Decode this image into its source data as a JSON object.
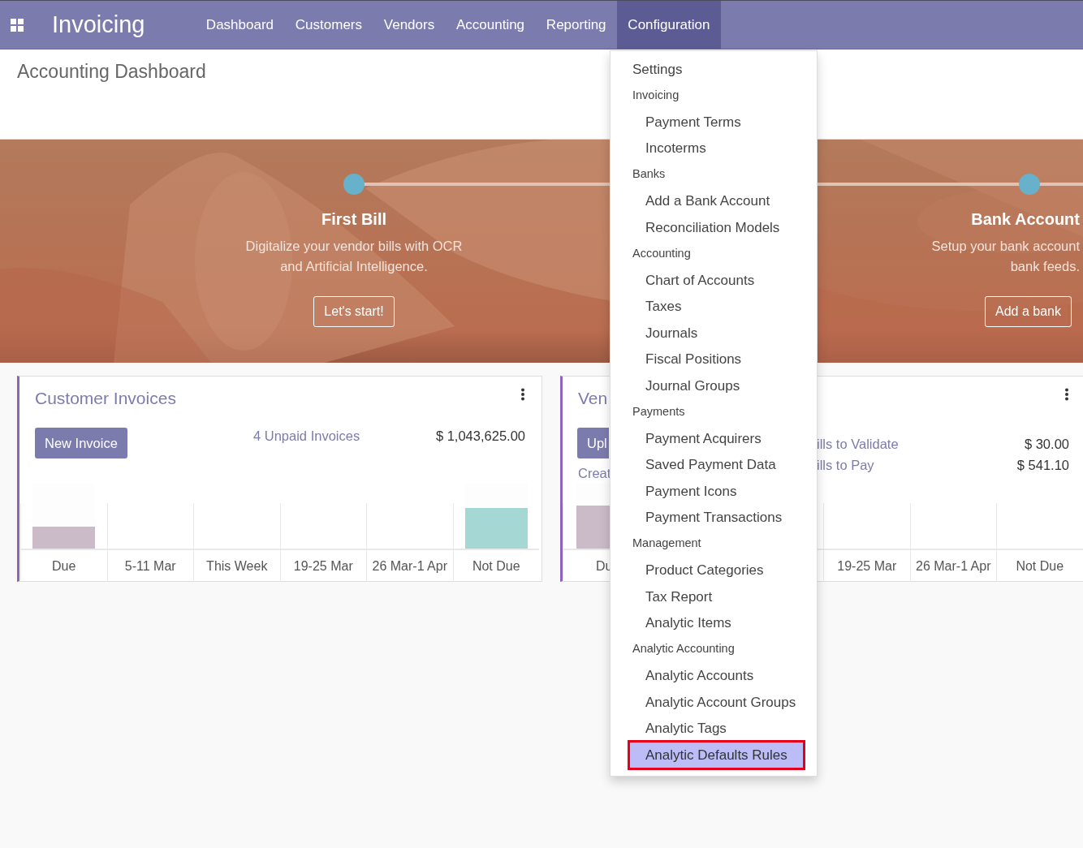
{
  "navbar": {
    "app_name": "Invoicing",
    "menu": [
      {
        "label": "Dashboard",
        "selected": false
      },
      {
        "label": "Customers",
        "selected": false
      },
      {
        "label": "Vendors",
        "selected": false
      },
      {
        "label": "Accounting",
        "selected": false
      },
      {
        "label": "Reporting",
        "selected": false
      },
      {
        "label": "Configuration",
        "selected": true
      }
    ]
  },
  "page_title": "Accounting Dashboard",
  "onboarding": {
    "steps": [
      {
        "title": "First Bill",
        "description_lines": [
          "Digitalize your vendor bills with OCR",
          "and Artificial Intelligence."
        ],
        "button": "Let's start!"
      },
      {
        "title": "Bank Account",
        "description_lines": [
          "Setup your bank account",
          "bank feeds."
        ],
        "button": "Add a bank"
      }
    ]
  },
  "customer_card": {
    "title": "Customer Invoices",
    "button": "New Invoice",
    "summary": [
      {
        "label": "4 Unpaid Invoices",
        "amount": "$ 1,043,625.00"
      }
    ],
    "chart": {
      "columns": [
        {
          "label": "Due",
          "level": 0.34,
          "color": "#cbbac8"
        },
        {
          "label": "5-11 Mar"
        },
        {
          "label": "This Week"
        },
        {
          "label": "19-25 Mar"
        },
        {
          "label": "26 Mar-1 Apr"
        },
        {
          "label": "Not Due",
          "level": 0.63,
          "color": "#a5d8d5"
        }
      ]
    }
  },
  "vendor_card": {
    "title": "Ven",
    "button": "Upl",
    "link": "Creat",
    "summary": [
      {
        "label": "ills to Validate",
        "amount": "$ 30.00"
      },
      {
        "label": "ills to Pay",
        "amount": "$ 541.10"
      }
    ],
    "chart": {
      "columns_left": [
        {
          "label": "Du",
          "level": 0.66,
          "color": "#cbbac8"
        }
      ],
      "columns_right": [
        {
          "label": "19-25 Mar"
        },
        {
          "label": "26 Mar-1 Apr"
        },
        {
          "label": "Not Due"
        }
      ]
    }
  },
  "dropdown": {
    "items": [
      {
        "label": "Settings",
        "selected": false
      },
      {
        "label": "Invoicing",
        "children": [
          {
            "label": "Payment Terms",
            "selected": false
          },
          {
            "label": "Incoterms",
            "selected": false
          }
        ]
      },
      {
        "label": "Banks",
        "children": [
          {
            "label": "Add a Bank Account",
            "selected": false
          },
          {
            "label": "Reconciliation Models",
            "selected": false
          }
        ]
      },
      {
        "label": "Accounting",
        "children": [
          {
            "label": "Chart of Accounts",
            "selected": false
          },
          {
            "label": "Taxes",
            "selected": false
          },
          {
            "label": "Journals",
            "selected": false
          },
          {
            "label": "Fiscal Positions",
            "selected": false
          },
          {
            "label": "Journal Groups",
            "selected": false
          }
        ]
      },
      {
        "label": "Payments",
        "children": [
          {
            "label": "Payment Acquirers",
            "selected": false
          },
          {
            "label": "Saved Payment Data",
            "selected": false
          },
          {
            "label": "Payment Icons",
            "selected": false
          },
          {
            "label": "Payment Transactions",
            "selected": false
          }
        ]
      },
      {
        "label": "Management",
        "children": [
          {
            "label": "Product Categories",
            "selected": false
          },
          {
            "label": "Tax Report",
            "selected": false
          },
          {
            "label": "Analytic Items",
            "selected": false
          }
        ]
      },
      {
        "label": "Analytic Accounting",
        "children": [
          {
            "label": "Analytic Accounts",
            "selected": false
          },
          {
            "label": "Analytic Account Groups",
            "selected": false
          },
          {
            "label": "Analytic Tags",
            "selected": false
          },
          {
            "label": "Analytic Defaults Rules",
            "selected": true
          }
        ]
      }
    ]
  }
}
